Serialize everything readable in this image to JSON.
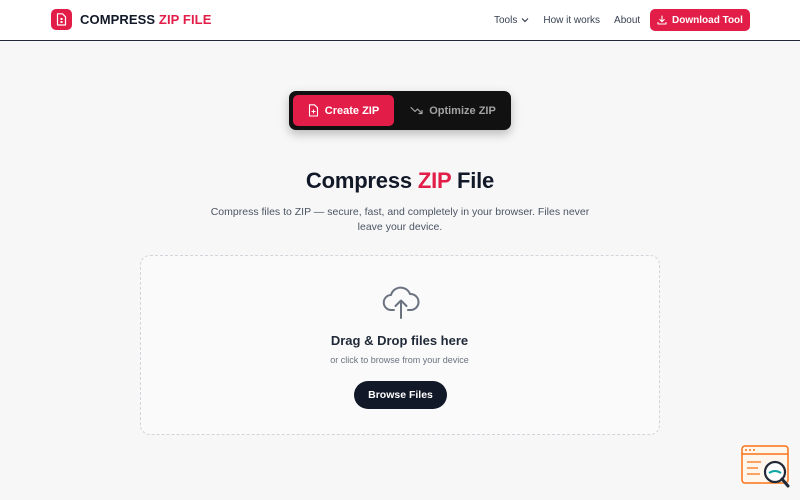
{
  "header": {
    "logo_text": "COMPRESS",
    "logo_accent": "ZIP FILE",
    "nav": [
      {
        "label": "Tools",
        "has_dropdown": true
      },
      {
        "label": "How it works"
      },
      {
        "label": "About"
      }
    ],
    "download_label": "Download Tool"
  },
  "tabs": {
    "active_label": "Create ZIP",
    "inactive_label": "Optimize ZIP"
  },
  "hero": {
    "title_start": "Compress",
    "title_accent": "ZIP",
    "title_end": "File",
    "subtitle": "Compress files to ZIP — secure, fast, and completely in your browser. Files never leave your device."
  },
  "dropzone": {
    "title": "Drag & Drop files here",
    "subtitle": "or click to browse from your device",
    "button_label": "Browse Files"
  },
  "icons": {
    "logo": "file-zip-icon",
    "download": "download-icon",
    "tab_create": "file-plus-icon",
    "tab_optimize": "trending-down-icon",
    "upload": "cloud-upload-icon",
    "help": "help-widget-icon"
  },
  "colors": {
    "accent": "#e11d48",
    "dark": "#111827",
    "background": "#f7f7f8"
  }
}
